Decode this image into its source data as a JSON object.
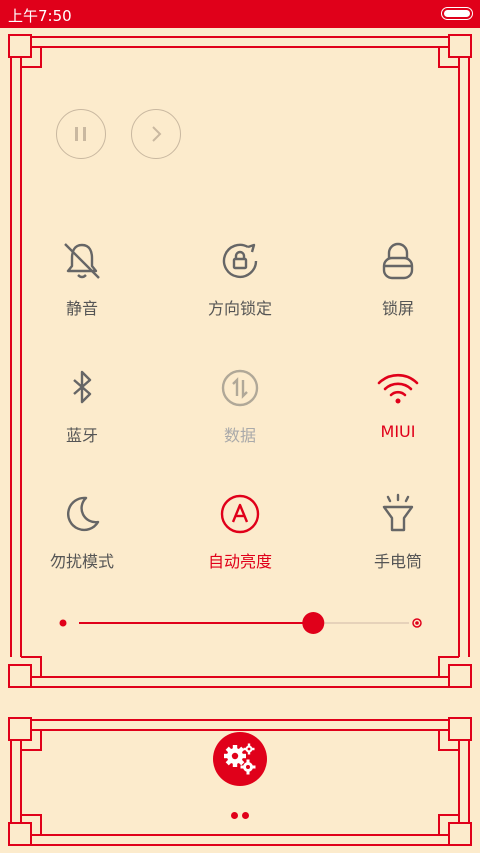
{
  "status_bar": {
    "time": "上午7:50"
  },
  "media": {
    "pause_icon": "pause-icon",
    "next_icon": "chevron-right-icon"
  },
  "tiles": [
    {
      "label": "静音",
      "icon": "bell-muted-icon",
      "state": "off"
    },
    {
      "label": "方向锁定",
      "icon": "rotation-lock-icon",
      "state": "off"
    },
    {
      "label": "锁屏",
      "icon": "lock-icon",
      "state": "off"
    },
    {
      "label": "蓝牙",
      "icon": "bluetooth-icon",
      "state": "off"
    },
    {
      "label": "数据",
      "icon": "mobile-data-icon",
      "state": "disabled"
    },
    {
      "label": "MIUI",
      "icon": "wifi-icon",
      "state": "on"
    },
    {
      "label": "勿扰模式",
      "icon": "moon-icon",
      "state": "off"
    },
    {
      "label": "自动亮度",
      "icon": "auto-brightness-icon",
      "state": "on"
    },
    {
      "label": "手电筒",
      "icon": "flashlight-icon",
      "state": "off"
    }
  ],
  "brightness": {
    "level": 0.71
  },
  "settings_button": {
    "icon": "gears-icon"
  },
  "pager": {
    "count": 2,
    "active": 0
  },
  "colors": {
    "accent": "#e0001a",
    "background": "#fcebcc",
    "icon_gray": "#666666"
  }
}
